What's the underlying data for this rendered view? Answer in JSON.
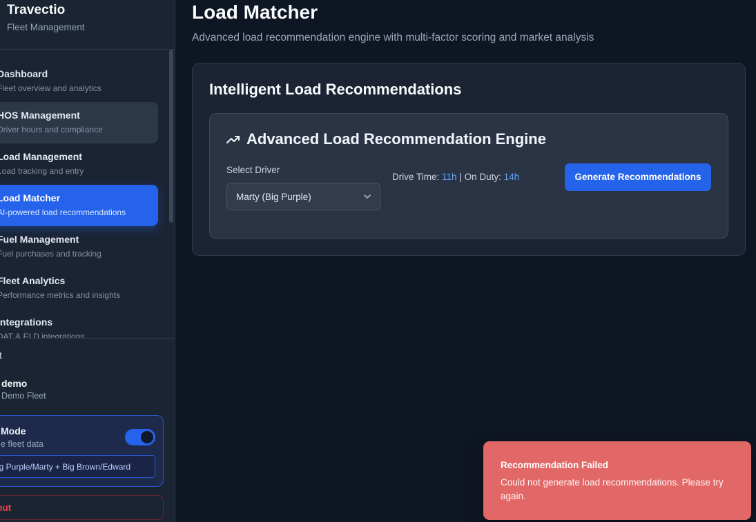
{
  "app": {
    "title": "Travectio",
    "subtitle": "Fleet Management"
  },
  "sidebar": {
    "items": [
      {
        "title": "Dashboard",
        "subtitle": "Fleet overview and analytics"
      },
      {
        "title": "HOS Management",
        "subtitle": "Driver hours and compliance"
      },
      {
        "title": "Load Management",
        "subtitle": "Load tracking and entry"
      },
      {
        "title": "Load Matcher",
        "subtitle": "AI-powered load recommendations"
      },
      {
        "title": "Fuel Management",
        "subtitle": "Fuel purchases and tracking"
      },
      {
        "title": "Fleet Analytics",
        "subtitle": "Performance metrics and insights"
      },
      {
        "title": "Integrations",
        "subtitle": "DAT & ELD integrations"
      }
    ],
    "bottom_text": "t",
    "user": {
      "name": "demo",
      "fleet": "Demo Fleet"
    },
    "demo_mode": {
      "title": "Mode",
      "subtitle": "e fleet data",
      "enabled": true,
      "pill": "ig Purple/Marty + Big Brown/Edward"
    },
    "logout_label": "gout"
  },
  "main": {
    "title": "Load Matcher",
    "subtitle": "Advanced load recommendation engine with multi-factor scoring and market analysis",
    "card_title": "Intelligent Load Recommendations",
    "engine": {
      "title": "Advanced Load Recommendation Engine",
      "icon": "trending-up-icon",
      "select_label": "Select Driver",
      "selected_driver": "Marty (Big Purple)",
      "drive_time_label": "Drive Time:",
      "drive_time_value": "11h",
      "separator": "|",
      "on_duty_label": "On Duty:",
      "on_duty_value": "14h",
      "button_label": "Generate Recommendations"
    }
  },
  "toast": {
    "title": "Recommendation Failed",
    "message": "Could not generate load recommendations. Please try again."
  },
  "colors": {
    "accent": "#2563eb",
    "toast_error": "#e26868",
    "background": "#0f1623",
    "sidebar": "#1b2433"
  }
}
